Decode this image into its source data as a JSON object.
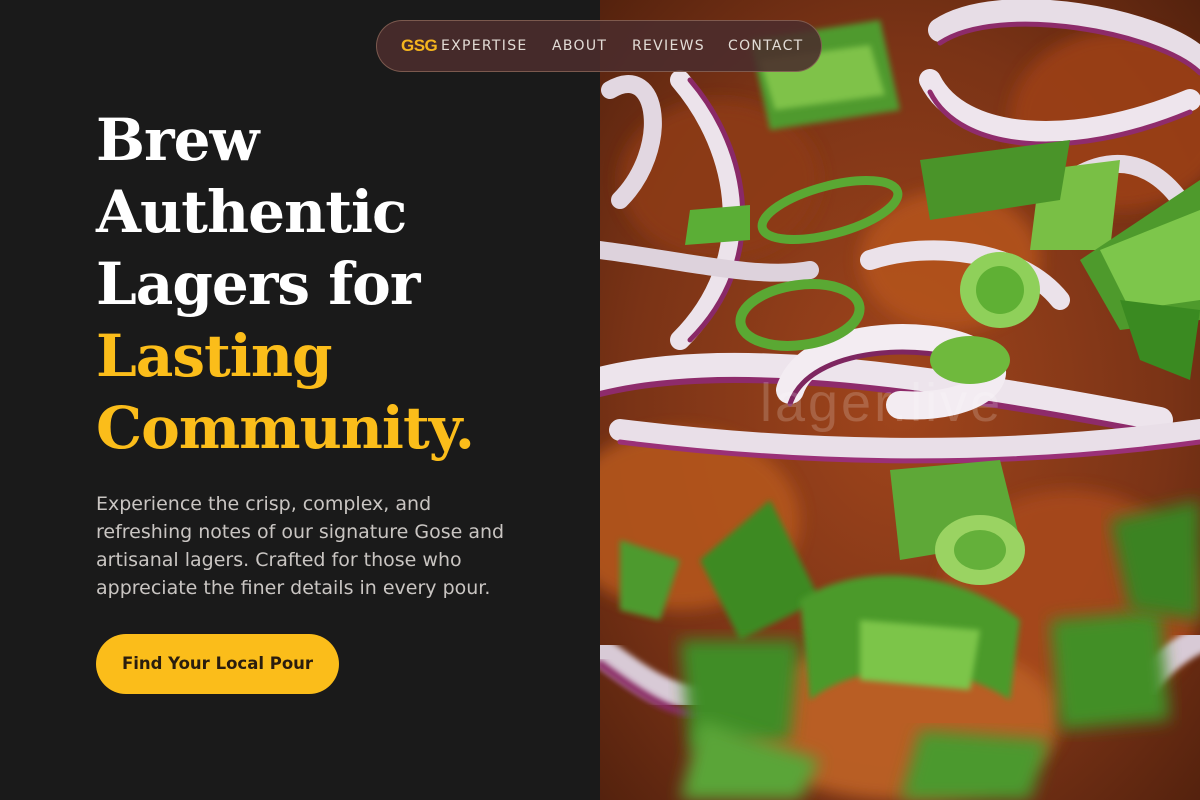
{
  "nav": {
    "logo": "GSG",
    "links": [
      "EXPERTISE",
      "ABOUT",
      "REVIEWS",
      "CONTACT"
    ]
  },
  "hero": {
    "headline_lines": [
      "Brew",
      "Authentic",
      "Lagers for"
    ],
    "headline_accent_lines": [
      "Lasting",
      "Community."
    ],
    "subtext": "Experience the crisp, complex, and refreshing notes of our signature Gose and artisanal lagers. Crafted for those who appreciate the finer details in every pour.",
    "cta_label": "Find Your Local Pour"
  },
  "image": {
    "subject": "close-up food photo with red onion rings and chopped green onions",
    "watermark": "lager.live"
  },
  "colors": {
    "accent": "#fbbd1a",
    "background": "#1a1a1a",
    "nav_background": "#4b2c2c",
    "text_light": "#ffffff",
    "text_muted": "#c9c5c2"
  }
}
